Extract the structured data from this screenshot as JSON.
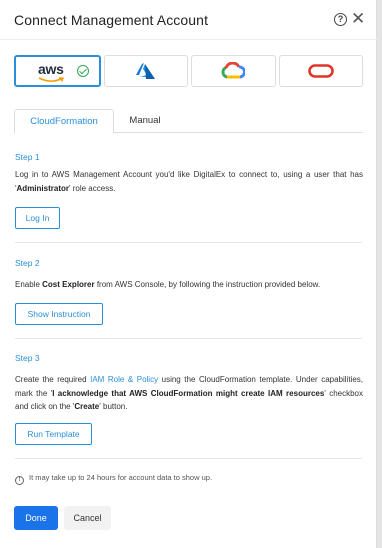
{
  "dialog": {
    "title": "Connect Management Account",
    "help_glyph": "?",
    "close_glyph": "✕"
  },
  "providers": [
    {
      "name": "aws-icon",
      "label": "aws",
      "selected": true
    },
    {
      "name": "azure-icon",
      "selected": false
    },
    {
      "name": "google-cloud-icon",
      "selected": false
    },
    {
      "name": "oracle-icon",
      "selected": false
    }
  ],
  "tabs": {
    "cloudformation": "CloudFormation",
    "manual": "Manual"
  },
  "step1": {
    "label": "Step 1",
    "text_a": "Log in to AWS Management Account you'd like DigitalEx to connect to, using a user that has '",
    "text_bold": "Administrator",
    "text_b": "' role access.",
    "button": "Log In"
  },
  "step2": {
    "label": "Step 2",
    "text_a": "Enable ",
    "text_bold": "Cost Explorer",
    "text_b": " from AWS Console, by following the instruction provided below.",
    "button": "Show Instruction"
  },
  "step3": {
    "label": "Step 3",
    "text_a": "Create the required ",
    "link": "IAM Role & Policy",
    "text_b": " using the CloudFormation template. Under capabilities, mark the '",
    "bold1": "I acknowledge that AWS CloudFormation might create IAM resources",
    "text_c": "' checkbox and click on the '",
    "bold2": "Create",
    "text_d": "' button.",
    "button": "Run Template"
  },
  "info": {
    "glyph": "!",
    "text": "It may take up to 24 hours for account data to show up."
  },
  "footer": {
    "done": "Done",
    "cancel": "Cancel"
  },
  "colors": {
    "accent": "#2a8fd8",
    "primary_button": "#1a73e8",
    "check": "#34a853"
  }
}
